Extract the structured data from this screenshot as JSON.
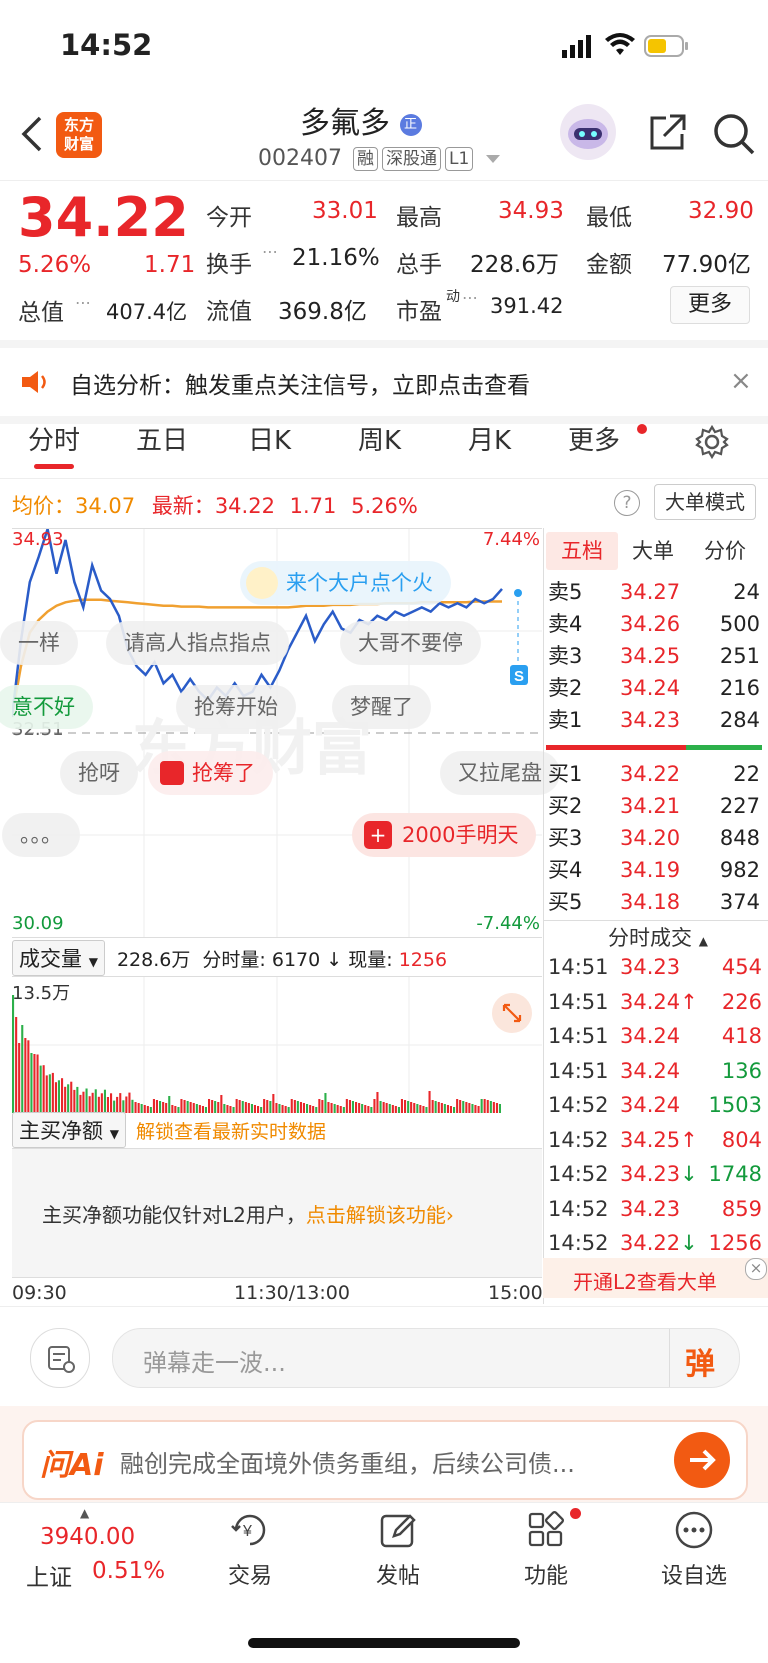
{
  "status": {
    "time": "14:52"
  },
  "header": {
    "logo_text_1": "东方",
    "logo_text_2": "财富",
    "stock_name": "多氟多",
    "name_badge": "正",
    "stock_code": "002407",
    "tags": [
      "融",
      "深股通",
      "L1"
    ]
  },
  "quote": {
    "price": "34.22",
    "change_pct": "5.26%",
    "change": "1.71",
    "total_value_label": "总值",
    "total_value": "407.4亿",
    "fields": [
      {
        "label": "今开",
        "value": "33.01"
      },
      {
        "label": "最高",
        "value": "34.93"
      },
      {
        "label": "最低",
        "value": "32.90"
      },
      {
        "label": "换手",
        "value": "21.16%"
      },
      {
        "label": "总手",
        "value": "228.6万"
      },
      {
        "label": "金额",
        "value": "77.90亿"
      },
      {
        "label": "流值",
        "value": "369.8亿"
      },
      {
        "label": "市盈",
        "value": "391.42"
      }
    ],
    "pe_superscript": "动",
    "more_button": "更多"
  },
  "notice": {
    "text": "自选分析：触发重点关注信号，立即点击查看"
  },
  "tabs": [
    "分时",
    "五日",
    "日K",
    "周K",
    "月K",
    "更多"
  ],
  "chart_info": {
    "avg_label": "均价：",
    "avg_value": "34.07",
    "latest_label": "最新：",
    "latest_value": "34.22",
    "latest_change": "1.71",
    "latest_pct": "5.26%",
    "mode_button": "大单模式",
    "help": "?"
  },
  "chart_data": {
    "type": "line",
    "title": "",
    "y_max_label": "34.93",
    "y_mid_label": "32.51",
    "y_min_label": "30.09",
    "pct_max_label": "7.44%",
    "pct_min_label": "-7.44%",
    "ylim": [
      30.09,
      34.93
    ],
    "prev_close": 32.51,
    "x_labels": [
      "09:30",
      "11:30/13:00",
      "15:00"
    ],
    "series": [
      {
        "values": [
          32.7,
          33.6,
          34.3,
          34.6,
          34.93,
          34.4,
          34.8,
          34.3,
          34.0,
          34.5,
          34.2,
          34.1,
          33.9,
          33.5,
          33.3,
          33.2,
          33.35,
          33.1,
          33.2,
          33.0,
          33.15,
          33.0,
          32.9,
          33.05,
          32.95,
          33.1,
          32.95,
          33.0,
          33.2,
          33.05,
          33.25,
          33.5,
          33.7,
          33.9,
          33.6,
          33.8,
          33.95,
          33.75,
          33.7,
          33.85,
          33.8,
          33.9,
          33.85,
          33.95,
          33.9,
          33.95,
          34.0,
          33.95,
          34.05,
          34.0,
          34.05,
          34.0,
          34.1,
          34.05,
          34.1,
          34.22
        ]
      },
      {
        "values": [
          32.7,
          33.3,
          33.7,
          33.85,
          33.95,
          34.02,
          34.06,
          34.08,
          34.09,
          34.09,
          34.09,
          34.08,
          34.07,
          34.06,
          34.05,
          34.04,
          34.03,
          34.02,
          34.02,
          34.01,
          34.01,
          34.01,
          34.0,
          34.0,
          34.0,
          34.0,
          34.0,
          34.0,
          34.0,
          34.0,
          34.0,
          34.0,
          34.01,
          34.02,
          34.02,
          34.02,
          34.03,
          34.03,
          34.03,
          34.04,
          34.04,
          34.04,
          34.05,
          34.05,
          34.05,
          34.05,
          34.06,
          34.06,
          34.06,
          34.06,
          34.06,
          34.06,
          34.07,
          34.07,
          34.07,
          34.07
        ]
      }
    ]
  },
  "danmaku": [
    "来个大户点个火",
    "一样",
    "请高人指点指点",
    "大哥不要停",
    "意不好",
    "抢筹开始",
    "梦醒了",
    "抢呀",
    "抢筹了",
    "又拉尾盘",
    "。。。",
    "2000手明天"
  ],
  "volume": {
    "selector": "成交量",
    "total": "228.6万",
    "period_label": "分时量:",
    "period_value": "6170",
    "current_label": "现量:",
    "current_value": "1256",
    "max_label": "13.5万"
  },
  "net_buy": {
    "selector": "主买净额",
    "unlock_text": "解锁查看最新实时数据",
    "info_text": "主买净额功能仅针对L2用户，",
    "unlock_link": "点击解锁该功能"
  },
  "orderbook": {
    "tabs": [
      "五档",
      "大单",
      "分价"
    ],
    "asks": [
      {
        "label": "卖5",
        "price": "34.27",
        "vol": "24"
      },
      {
        "label": "卖4",
        "price": "34.26",
        "vol": "500"
      },
      {
        "label": "卖3",
        "price": "34.25",
        "vol": "251"
      },
      {
        "label": "卖2",
        "price": "34.24",
        "vol": "216"
      },
      {
        "label": "卖1",
        "price": "34.23",
        "vol": "284"
      }
    ],
    "bids": [
      {
        "label": "买1",
        "price": "34.22",
        "vol": "22"
      },
      {
        "label": "买2",
        "price": "34.21",
        "vol": "227"
      },
      {
        "label": "买3",
        "price": "34.20",
        "vol": "848"
      },
      {
        "label": "买4",
        "price": "34.19",
        "vol": "982"
      },
      {
        "label": "买5",
        "price": "34.18",
        "vol": "374"
      }
    ],
    "trades_title": "分时成交",
    "trades": [
      {
        "time": "14:51",
        "price": "34.23",
        "vol": "454",
        "dir": "",
        "color": "red"
      },
      {
        "time": "14:51",
        "price": "34.24",
        "vol": "226",
        "dir": "↑",
        "color": "red"
      },
      {
        "time": "14:51",
        "price": "34.24",
        "vol": "418",
        "dir": "",
        "color": "red"
      },
      {
        "time": "14:51",
        "price": "34.24",
        "vol": "136",
        "dir": "",
        "color": "green"
      },
      {
        "time": "14:52",
        "price": "34.24",
        "vol": "1503",
        "dir": "",
        "color": "green"
      },
      {
        "time": "14:52",
        "price": "34.25",
        "vol": "804",
        "dir": "↑",
        "color": "red"
      },
      {
        "time": "14:52",
        "price": "34.23",
        "vol": "1748",
        "dir": "↓",
        "color": "green"
      },
      {
        "time": "14:52",
        "price": "34.23",
        "vol": "859",
        "dir": "",
        "color": "red"
      },
      {
        "time": "14:52",
        "price": "34.22",
        "vol": "1256",
        "dir": "↓",
        "color": "red"
      }
    ],
    "l2_text": "开通L2查看大单"
  },
  "comment": {
    "placeholder": "弹幕走一波...",
    "send": "弹"
  },
  "ai": {
    "logo": "问Ai",
    "text": "融创完成全面境外债务重组，后续公司债..."
  },
  "bottom_nav": {
    "index_value": "3940.00",
    "index_name": "上证",
    "index_pct": "0.51%",
    "items": [
      "交易",
      "发帖",
      "功能",
      "设自选"
    ]
  },
  "colors": {
    "up": "#e8262a",
    "down": "#139a3c",
    "accent": "#f25a12",
    "avg": "#f0a030",
    "price_line": "#2a5cc8"
  }
}
